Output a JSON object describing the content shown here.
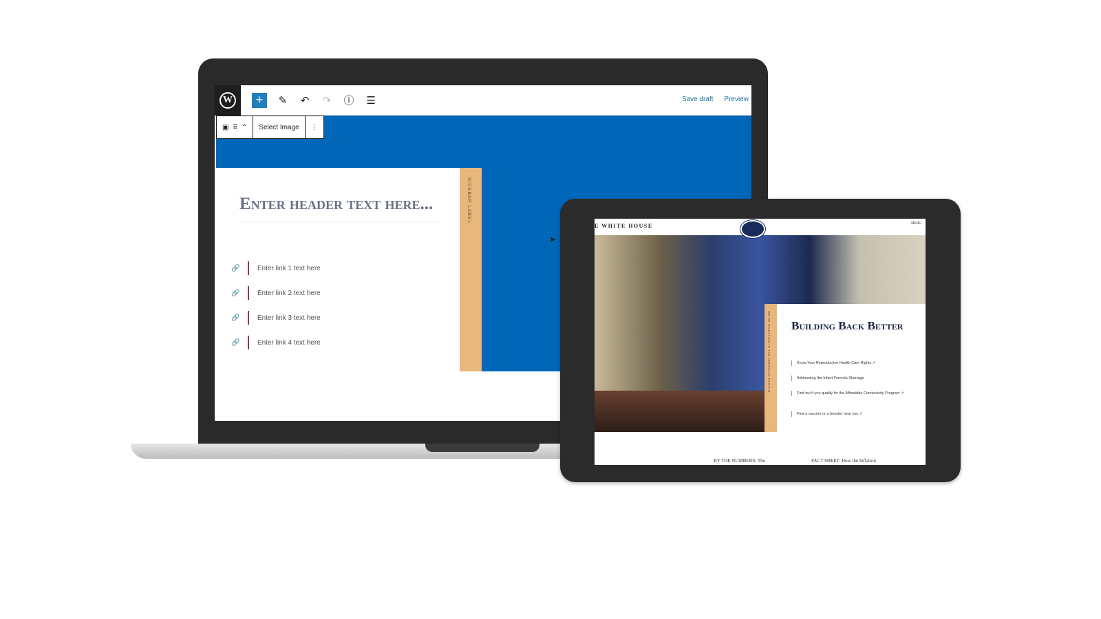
{
  "editor": {
    "toolbar": {
      "wp_logo": "W",
      "add": "+",
      "icons": [
        "pencil-icon",
        "undo-icon",
        "redo-icon",
        "info-icon",
        "list-view-icon"
      ],
      "save_draft": "Save draft",
      "preview": "Preview"
    },
    "block_toolbar": {
      "select_image": "Select Image",
      "more": "⋮"
    },
    "header_text": "Enter header text here...",
    "links": [
      "Enter link 1 text here",
      "Enter link 2 text here",
      "Enter link 3 text here",
      "Enter link 4 text here"
    ],
    "sidebar_label": "SIDEBAR LABEL",
    "accent": "#0066b8"
  },
  "tablet": {
    "site_title": "E WHITE HOUSE",
    "menu": "MENU",
    "vertical_label": "WE'RE INVESTING IN THE AMERICAN PEOPLE",
    "heading": "Building Back Better",
    "links": [
      "Know Your Reproductive Health Care Rights ↗",
      "Addressing the Infant Formula Shortage",
      "Find out if you qualify for the Affordable Connectivity Program ↗",
      "Find a vaccine or a booster near you ↗"
    ],
    "bottom": [
      "BY THE NUMBERS: The",
      "FACT SHEET: How the Inflation"
    ]
  }
}
